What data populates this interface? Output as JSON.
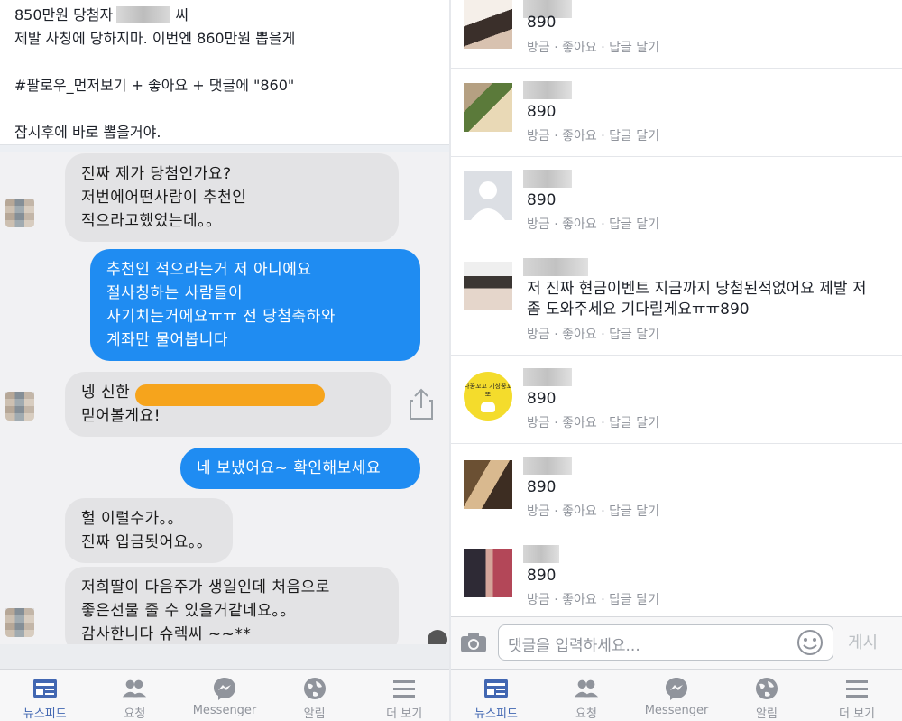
{
  "left": {
    "post": {
      "line1_prefix": "850만원 당첨자",
      "line1_suffix": "씨",
      "line2": "제발 사칭에 당하지마. 이번엔 860만원 뽑을게",
      "line3": "#팔로우_먼저보기 + 좋아요 + 댓글에 \"860\"",
      "line4": "잠시후에 바로 뽑을거야."
    },
    "chat": {
      "bubbles": [
        {
          "lines": [
            "진짜 제가 당첨인가요?",
            "저번에어떤사람이 추천인",
            "적으라고했었는데。。"
          ]
        },
        {
          "lines": [
            "추천인 적으라는거 저 아니에요",
            "절사칭하는 사람들이",
            "사기치는거에요ㅠㅠ 전 당첨축하와",
            "계좌만 물어봅니다"
          ]
        },
        {
          "lines": [
            "넹 신한",
            "믿어볼게요!"
          ]
        },
        {
          "lines": [
            "네 보냈어요~ 확인해보세요"
          ]
        },
        {
          "lines": [
            "헐 이럴수가。。",
            "진짜 입금됫어요。。"
          ]
        },
        {
          "lines": [
            "저희딸이 다음주가 생일인데 처음으로",
            "좋은선물 줄 수 있을거같네요。。",
            "감사한니다 슈렉씨 ~~**"
          ]
        }
      ]
    }
  },
  "right": {
    "comments": [
      {
        "text": [
          "890"
        ],
        "actions": "방금 · 좋아요 · 답글 달기"
      },
      {
        "text": [
          "890"
        ],
        "actions": "방금 · 좋아요 · 답글 달기"
      },
      {
        "text": [
          "890"
        ],
        "actions": "방금 · 좋아요 · 답글 달기"
      },
      {
        "text": [
          "저 진짜 현금이벤트 지금까지 당첨된적없어요 제발 저",
          "좀 도와주세요 기다릴게요ㅠㅠ890"
        ],
        "actions": "방금 · 좋아요 · 답글 달기"
      },
      {
        "text": [
          "890"
        ],
        "actions": "방금 · 좋아요 · 답글 달기",
        "avatar_label": "나꿍꼬꼬 기싱꿍꼬또"
      },
      {
        "text": [
          "890"
        ],
        "actions": "방금 · 좋아요 · 답글 달기"
      },
      {
        "text": [
          "890"
        ],
        "actions": "방금 · 좋아요 · 답글 달기"
      }
    ],
    "input": {
      "placeholder": "댓글을 입력하세요...",
      "post_label": "게시"
    }
  },
  "tabs": [
    {
      "label": "뉴스피드",
      "icon": "newsfeed-icon",
      "active": true
    },
    {
      "label": "요청",
      "icon": "friend-requests-icon"
    },
    {
      "label": "Messenger",
      "icon": "messenger-icon"
    },
    {
      "label": "알림",
      "icon": "globe-notifications-icon"
    },
    {
      "label": "더 보기",
      "icon": "menu-icon"
    }
  ],
  "colors": {
    "accent": "#4267b2",
    "outgoing_bubble": "#1f8cf2",
    "incoming_bubble": "#e3e3e5",
    "redaction": "#f6a41c"
  }
}
